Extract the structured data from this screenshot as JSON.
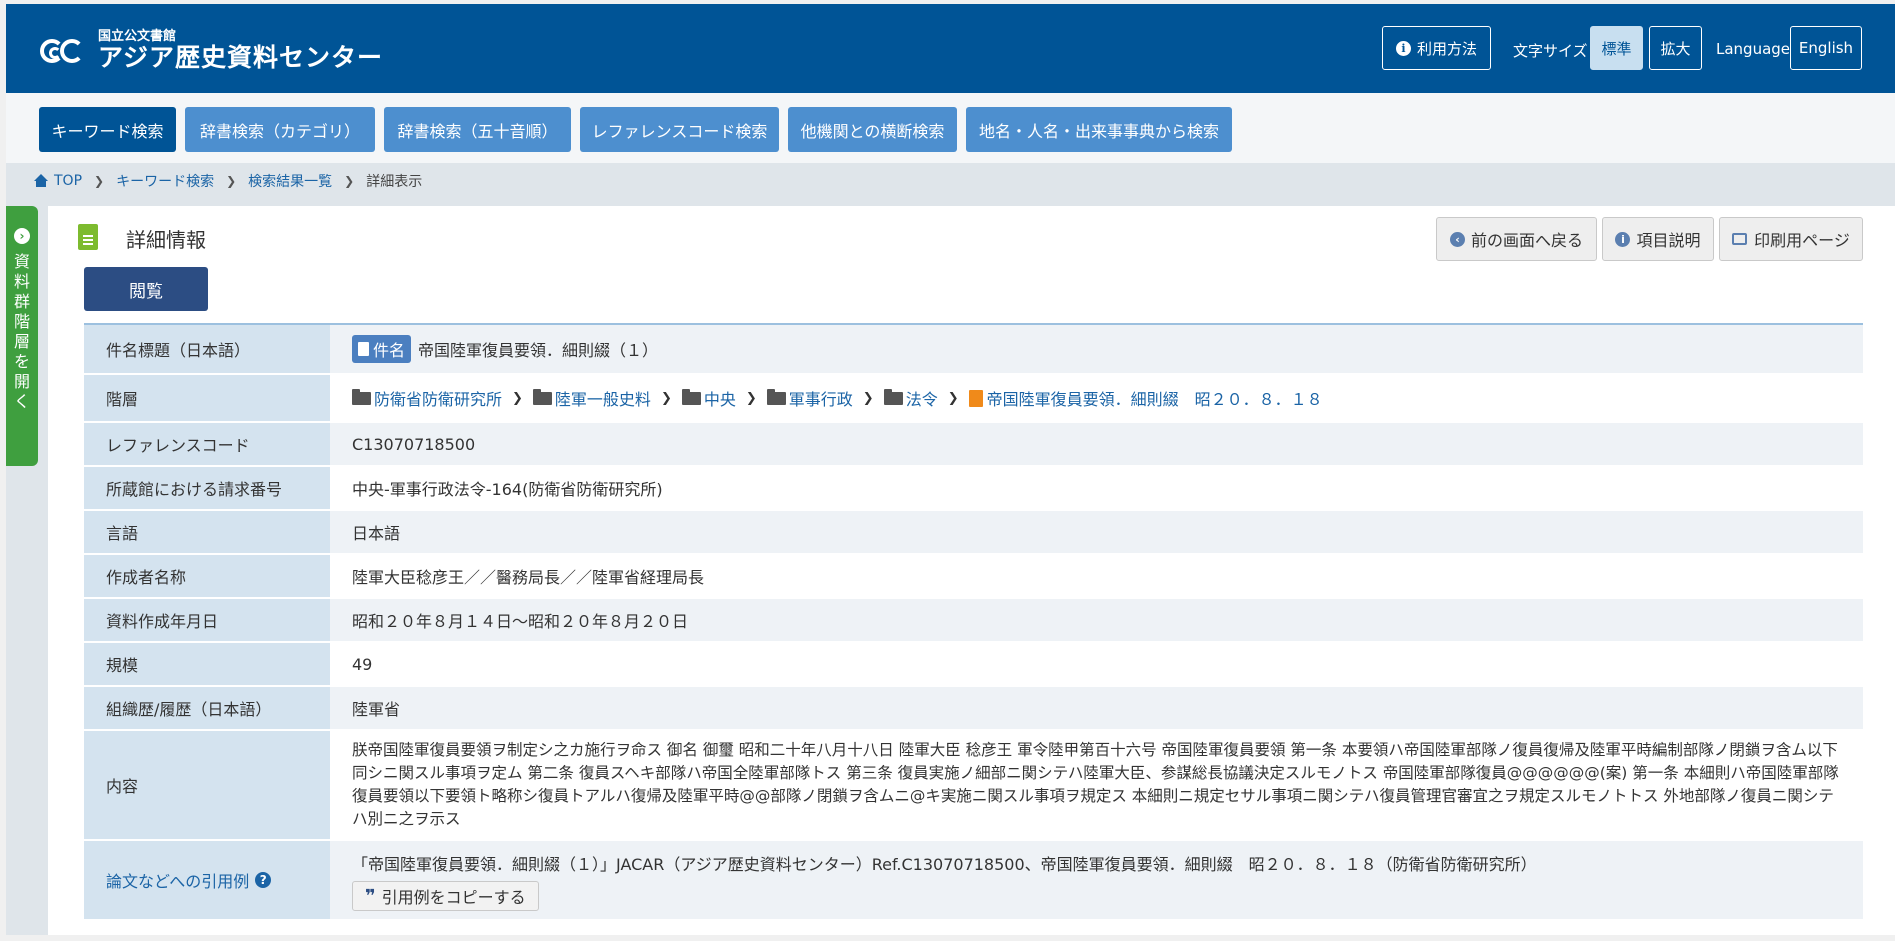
{
  "header": {
    "logo_sub": "国立公文書館",
    "logo_main": "アジア歴史資料センター",
    "usage_label": "利用方法",
    "font_size_label": "文字サイズ",
    "font_standard": "標準",
    "font_large": "拡大",
    "language_label": "Language",
    "language_button": "English"
  },
  "nav": {
    "tabs": [
      {
        "label": "キーワード検索"
      },
      {
        "label": "辞書検索（カテゴリ）"
      },
      {
        "label": "辞書検索（五十音順）"
      },
      {
        "label": "レファレンスコード検索"
      },
      {
        "label": "他機関との横断検索"
      },
      {
        "label": "地名・人名・出来事事典から検索"
      }
    ]
  },
  "breadcrumb": {
    "top": "TOP",
    "keyword": "キーワード検索",
    "results": "検索結果一覧",
    "current": "詳細表示"
  },
  "sidetab": {
    "label": "資料群階層を開く"
  },
  "page": {
    "title": "詳細情報",
    "view_button": "閲覧",
    "back_button": "前の画面へ戻る",
    "explain_button": "項目説明",
    "print_button": "印刷用ページ"
  },
  "details": {
    "title_label": "件名標題（日本語）",
    "title_badge": "件名",
    "title_value": "帝国陸軍復員要領．細則綴（１）",
    "hierarchy_label": "階層",
    "hierarchy": [
      "防衛省防衛研究所",
      "陸軍一般史料",
      "中央",
      "軍事行政",
      "法令",
      "帝国陸軍復員要領．細則綴　昭２０．８．１８"
    ],
    "refcode_label": "レファレンスコード",
    "refcode_value": "C13070718500",
    "request_label": "所蔵館における請求番号",
    "request_value": "中央-軍事行政法令-164(防衛省防衛研究所)",
    "language_label": "言語",
    "language_value": "日本語",
    "author_label": "作成者名称",
    "author_value": "陸軍大臣稔彦王／／醫務局長／／陸軍省経理局長",
    "date_label": "資料作成年月日",
    "date_value": "昭和２０年８月１４日～昭和２０年８月２０日",
    "scale_label": "規模",
    "scale_value": "49",
    "org_label": "組織歴/履歴（日本語）",
    "org_value": "陸軍省",
    "content_label": "内容",
    "content_value": "朕帝国陸軍復員要領ヲ制定シ之カ施行ヲ命ス 御名 御璽 昭和二十年八月十八日 陸軍大臣 稔彦王 軍令陸甲第百十六号 帝国陸軍復員要領 第一条 本要領ハ帝国陸軍部隊ノ復員復帰及陸軍平時編制部隊ノ閉鎖ヲ含ム以下同シニ関スル事項ヲ定ム 第二条 復員スヘキ部隊ハ帝国全陸軍部隊トス 第三条 復員実施ノ細部ニ関シテハ陸軍大臣、参謀総長協議決定スルモノトス 帝国陸軍部隊復員@@@@@@(案) 第一条 本細則ハ帝国陸軍部隊復員要領以下要領ト略称シ復員トアルハ復帰及陸軍平時@@部隊ノ閉鎖ヲ含ムニ@キ実施ニ関スル事項ヲ規定ス 本細則ニ規定セサル事項ニ関シテハ復員管理官審宜之ヲ規定スルモノトトス 外地部隊ノ復員ニ関シテハ別ニ之ヲ示ス",
    "citation_label": "論文などへの引用例",
    "citation_value": "「帝国陸軍復員要領．細則綴（１）」JACAR（アジア歴史資料センター）Ref.C13070718500、帝国陸軍復員要領．細則綴　昭２０．８．１８（防衛省防衛研究所）",
    "copy_button": "引用例をコピーする"
  },
  "colors": {
    "header_bg": "#005496",
    "tab_bg": "#4d8fcf",
    "tab_active_bg": "#005496",
    "label_cell_bg": "#d4e3ef",
    "sidetab_bg": "#3f9f3f",
    "link": "#1b64a6"
  }
}
